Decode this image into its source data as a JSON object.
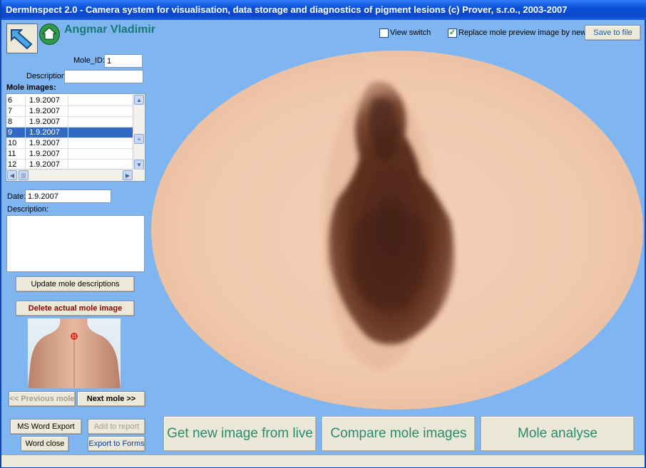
{
  "window": {
    "title": "DermInspect 2.0 - Camera system for visualisation, data storage and diagnostics of pigment lesions (c) Prover, s.r.o., 2003-2007"
  },
  "patient": {
    "name": "Angmar Vladimir"
  },
  "mole": {
    "id_label": "Mole_ID:",
    "id_value": "1",
    "description_label": "Description:",
    "description_value": ""
  },
  "images": {
    "label": "Mole images:",
    "rows": [
      {
        "num": "6",
        "date": "1.9.2007"
      },
      {
        "num": "7",
        "date": "1.9.2007"
      },
      {
        "num": "8",
        "date": "1.9.2007"
      },
      {
        "num": "9",
        "date": "1.9.2007"
      },
      {
        "num": "10",
        "date": "1.9.2007"
      },
      {
        "num": "11",
        "date": "1.9.2007"
      },
      {
        "num": "12",
        "date": "1.9.2007"
      }
    ],
    "selected_index": 3
  },
  "image_detail": {
    "date_label": "Date:",
    "date_value": "1.9.2007",
    "description_label": "Description:",
    "description_value": ""
  },
  "buttons": {
    "update": "Update mole descriptions",
    "delete": "Delete actual mole image",
    "prev": "<< Previous mole",
    "next": "Next mole   >>",
    "ms_word": "MS Word Export",
    "add_report": "Add to report",
    "word_close": "Word close",
    "export_forms": "Export to Forms",
    "save": "Save to file",
    "get_live": "Get new image from live",
    "compare": "Compare mole images",
    "analyse": "Mole analyse"
  },
  "options": {
    "view_switch": {
      "label": "View switch",
      "checked": false
    },
    "replace_preview": {
      "label": "Replace mole preview image by new",
      "checked": true
    }
  },
  "icons": {
    "back": "back-arrow-icon",
    "home": "home-icon"
  },
  "colors": {
    "title_blue": "#0a4fd8",
    "panel": "#7fb6f2",
    "accent_teal": "#1a8a7a",
    "delete_red": "#8b0000"
  }
}
